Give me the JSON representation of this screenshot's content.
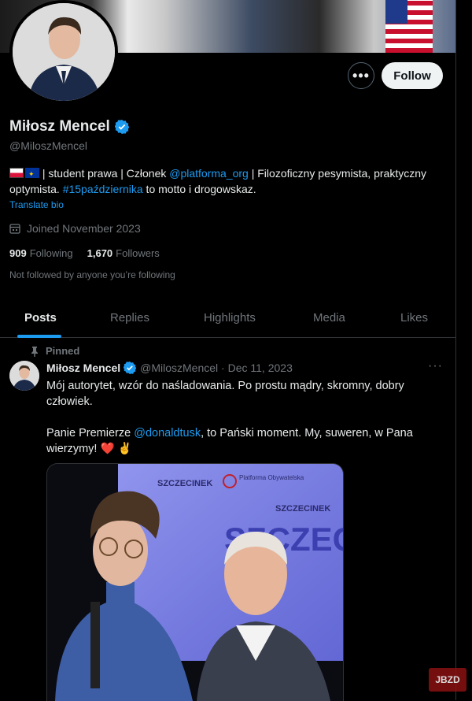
{
  "profile": {
    "name": "Miłosz Mencel",
    "handle": "@MiloszMencel",
    "bio_p1": " | student prawa | Członek ",
    "bio_mention": "@platforma_org",
    "bio_p2": " | Filozoficzny pesymista, praktyczny optymista. ",
    "bio_hashtag": "#15października",
    "bio_p3": " to motto i drogowskaz.",
    "translate_label": "Translate bio",
    "joined": "Joined November 2023",
    "following_count": "909",
    "following_label": "Following",
    "followers_count": "1,670",
    "followers_label": "Followers",
    "not_followed": "Not followed by anyone you’re following"
  },
  "actions": {
    "more_label": "•••",
    "follow_label": "Follow"
  },
  "tabs": [
    {
      "label": "Posts",
      "active": true
    },
    {
      "label": "Replies"
    },
    {
      "label": "Highlights"
    },
    {
      "label": "Media"
    },
    {
      "label": "Likes"
    }
  ],
  "tweet": {
    "pinned_label": "Pinned",
    "author_name": "Miłosz Mencel",
    "author_handle": "@MiloszMencel",
    "separator": " · ",
    "date": "Dec 11, 2023",
    "more_label": "···",
    "text1": "Mój autorytet, wzór do naśladowania. Po prostu mądry, skromny, dobry człowiek.",
    "text2_a": "Panie Premierze ",
    "text2_mention": "@donaldtusk",
    "text2_b": ", to Pański moment. My, suweren, w Pana wierzymy! ❤️ ✌️",
    "media_sign_top": "SZCZECINEK",
    "media_sign_big": "SZCZECINE",
    "media_po": "Platforma Obywatelska"
  },
  "watermark": "JBZD",
  "colors": {
    "accent": "#1d9bf0",
    "bg": "#000000",
    "text": "#e7e9ea",
    "muted": "#71767b"
  }
}
